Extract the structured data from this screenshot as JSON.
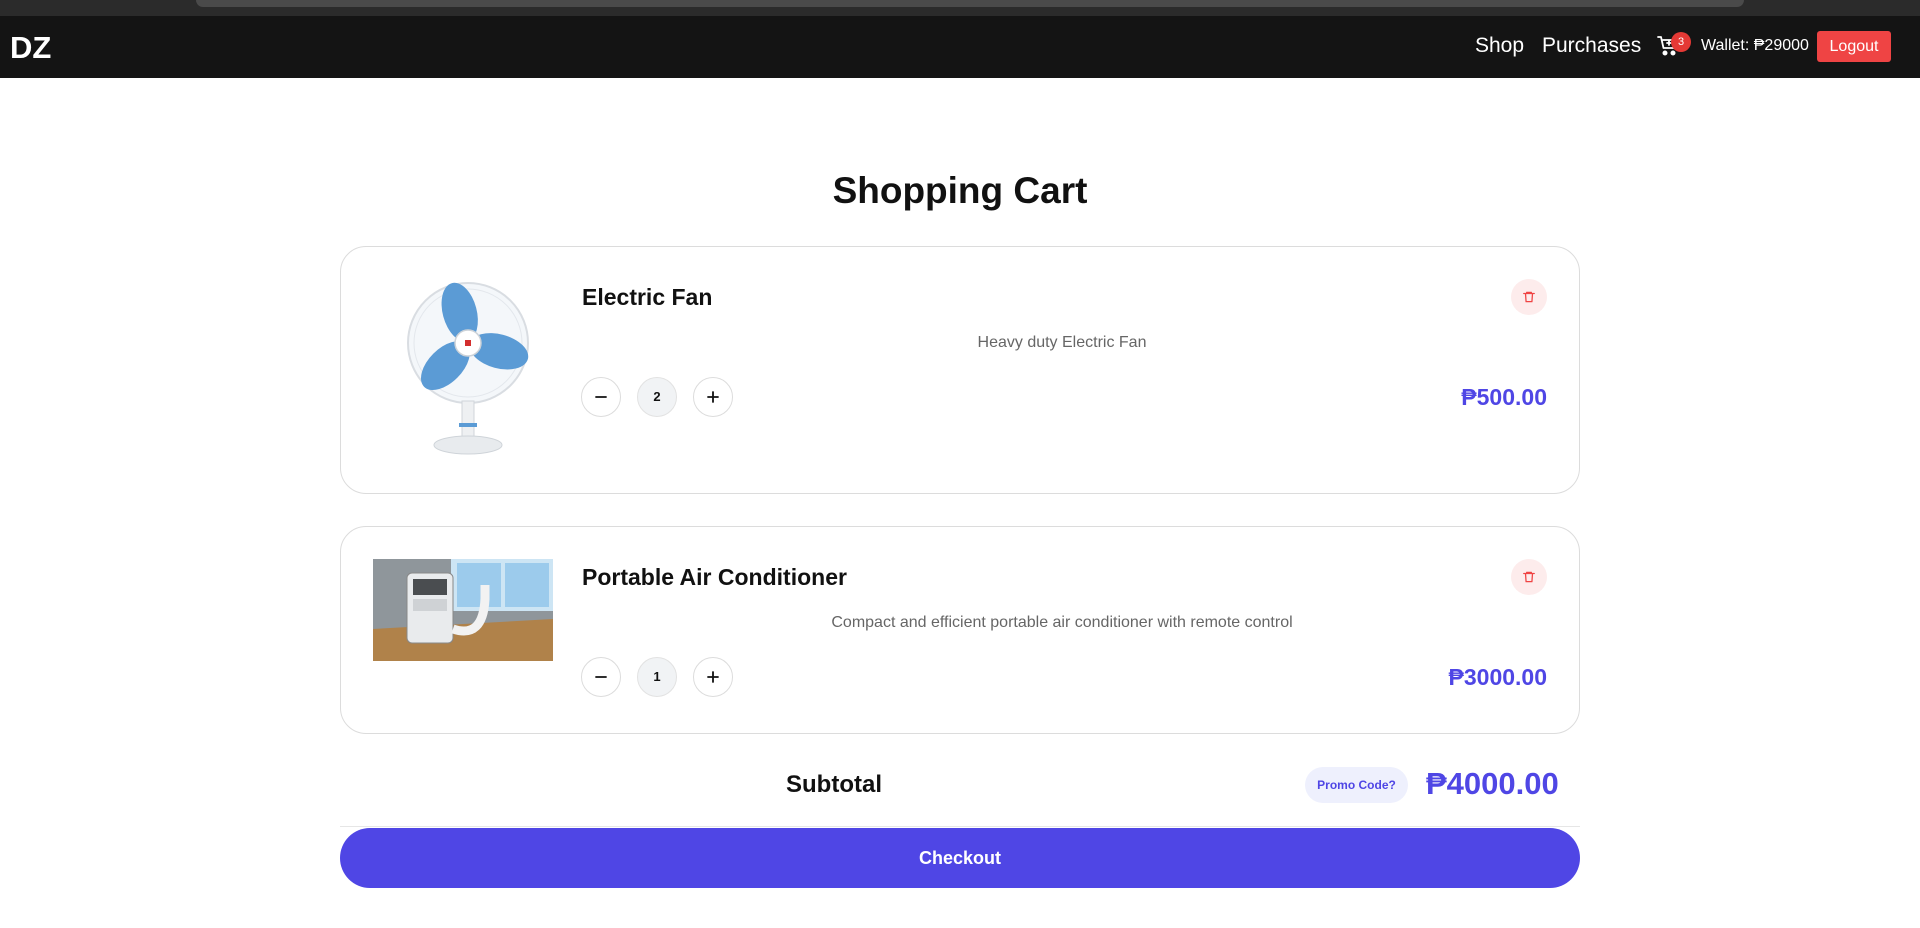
{
  "navbar": {
    "logo": "DZ",
    "links": [
      "Shop",
      "Purchases"
    ],
    "cart_count": "3",
    "wallet": "Wallet: ₱29000",
    "logout_label": "Logout"
  },
  "page": {
    "title": "Shopping Cart"
  },
  "cart": {
    "items": [
      {
        "name": "Electric Fan",
        "description": "Heavy duty Electric Fan",
        "quantity": "2",
        "price": "₱500.00"
      },
      {
        "name": "Portable Air Conditioner",
        "description": "Compact and efficient portable air conditioner with remote control",
        "quantity": "1",
        "price": "₱3000.00"
      }
    ]
  },
  "summary": {
    "subtotal_label": "Subtotal",
    "promo_label": "Promo Code?",
    "subtotal_value": "₱4000.00",
    "checkout_label": "Checkout"
  },
  "icons": {
    "cart": "shopping-cart-icon",
    "delete": "trash-icon",
    "minus": "minus-icon",
    "plus": "plus-icon"
  },
  "colors": {
    "accent": "#4f46e5",
    "navbar": "#141414",
    "logout": "#ef4444",
    "badge": "#e53935",
    "delete_bg": "#fdecec"
  }
}
